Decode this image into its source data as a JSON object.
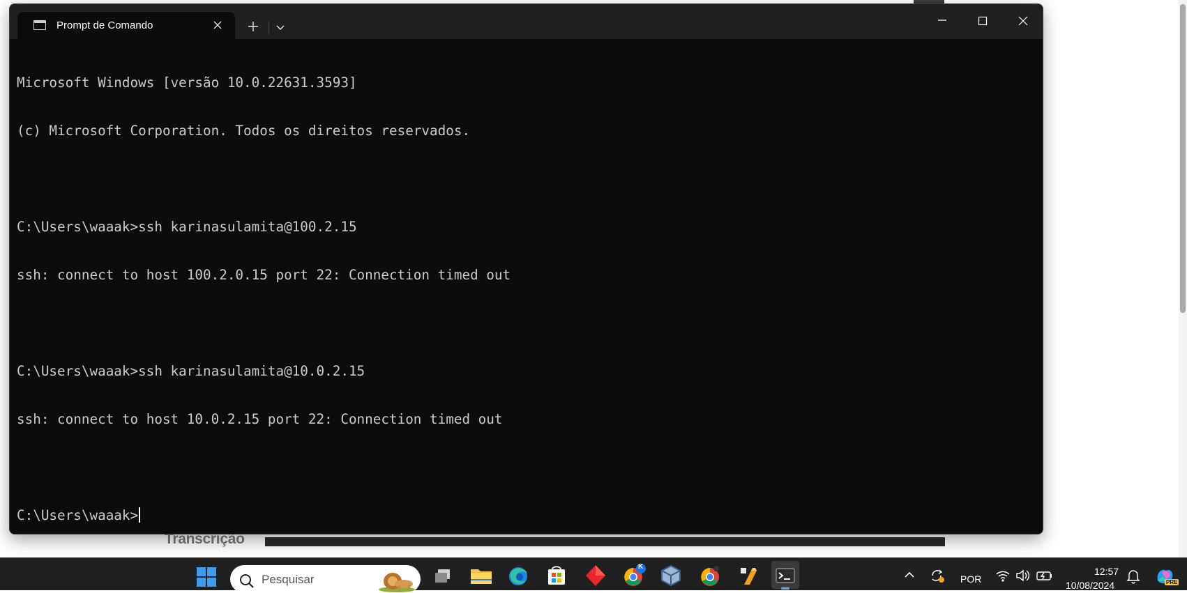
{
  "background": {
    "label": "Transcrição"
  },
  "terminal": {
    "tab_title": "Prompt de Comando",
    "lines": [
      "Microsoft Windows [versão 10.0.22631.3593]",
      "(c) Microsoft Corporation. Todos os direitos reservados.",
      "",
      "C:\\Users\\waaak>ssh karinasulamita@100.2.15",
      "ssh: connect to host 100.2.0.15 port 22: Connection timed out",
      "",
      "C:\\Users\\waaak>ssh karinasulamita@10.0.2.15",
      "ssh: connect to host 10.0.2.15 port 22: Connection timed out",
      ""
    ],
    "prompt": "C:\\Users\\waaak>"
  },
  "taskbar": {
    "search_placeholder": "Pesquisar",
    "language": "POR",
    "time": "12:57",
    "date": "10/08/2024",
    "apps": [
      {
        "icon": "windows-start-icon"
      },
      {
        "icon": "task-view-icon"
      },
      {
        "icon": "file-explorer-icon"
      },
      {
        "icon": "edge-icon"
      },
      {
        "icon": "microsoft-store-icon"
      },
      {
        "icon": "app-red-diamond-icon"
      },
      {
        "icon": "chrome-profile-icon"
      },
      {
        "icon": "virtualbox-icon"
      },
      {
        "icon": "chrome-icon"
      },
      {
        "icon": "app-tool-icon"
      },
      {
        "icon": "terminal-icon"
      }
    ],
    "badge_letter": "K",
    "copilot_badge": "PRE"
  },
  "colors": {
    "terminal_bg": "#0c0c0c",
    "terminal_text": "#cccccc",
    "titlebar_bg": "#202020",
    "taskbar_bg": "#202020"
  }
}
